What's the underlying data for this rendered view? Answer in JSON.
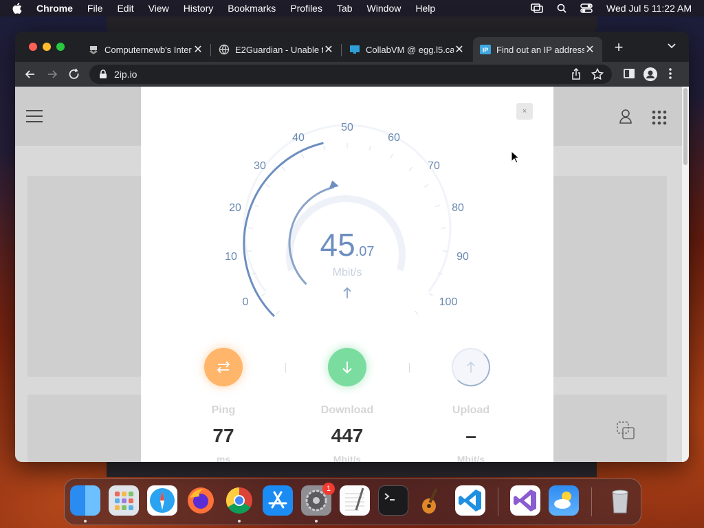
{
  "menubar": {
    "app": "Chrome",
    "items": [
      "File",
      "Edit",
      "View",
      "History",
      "Bookmarks",
      "Profiles",
      "Tab",
      "Window",
      "Help"
    ],
    "datetime": "Wed Jul 5  11:22 AM"
  },
  "tabs": [
    {
      "label": "Computernewb's Inter",
      "icon": "computernewb-icon",
      "active": false
    },
    {
      "label": "E2Guardian - Unable t",
      "icon": "globe-icon",
      "active": false
    },
    {
      "label": "CollabVM @ egg.l5.ca",
      "icon": "monitor-icon",
      "active": false
    },
    {
      "label": "Find out an IP address",
      "icon": "ip-icon",
      "active": true
    }
  ],
  "toolbar": {
    "url": "2ip.io"
  },
  "modal": {
    "close": "×",
    "gauge": {
      "ticks": [
        "0",
        "10",
        "20",
        "30",
        "40",
        "50",
        "60",
        "70",
        "80",
        "90",
        "100"
      ],
      "value": 45.07,
      "max": 100,
      "speed_int": "45",
      "speed_frac": ".07",
      "unit": "Mbit/s"
    },
    "stats": {
      "ping": {
        "label": "Ping",
        "value": "77",
        "unit": "ms"
      },
      "download": {
        "label": "Download",
        "value": "447",
        "unit": "Mbit/s"
      },
      "upload": {
        "label": "Upload",
        "value": "–",
        "unit": "Mbit/s"
      }
    }
  },
  "dock": {
    "apps": [
      "Finder",
      "Launchpad",
      "Safari",
      "Firefox",
      "Chrome",
      "App Store",
      "System Settings",
      "TextEdit",
      "Terminal",
      "GarageBand",
      "Visual Studio Code",
      "Visual Studio",
      "Weather",
      "Trash"
    ],
    "system_settings_badge": "1"
  },
  "colors": {
    "gauge": "#6d8ec0",
    "ping": "#ffb56a",
    "download": "#7bdca0",
    "tab_active": "#35363a"
  }
}
